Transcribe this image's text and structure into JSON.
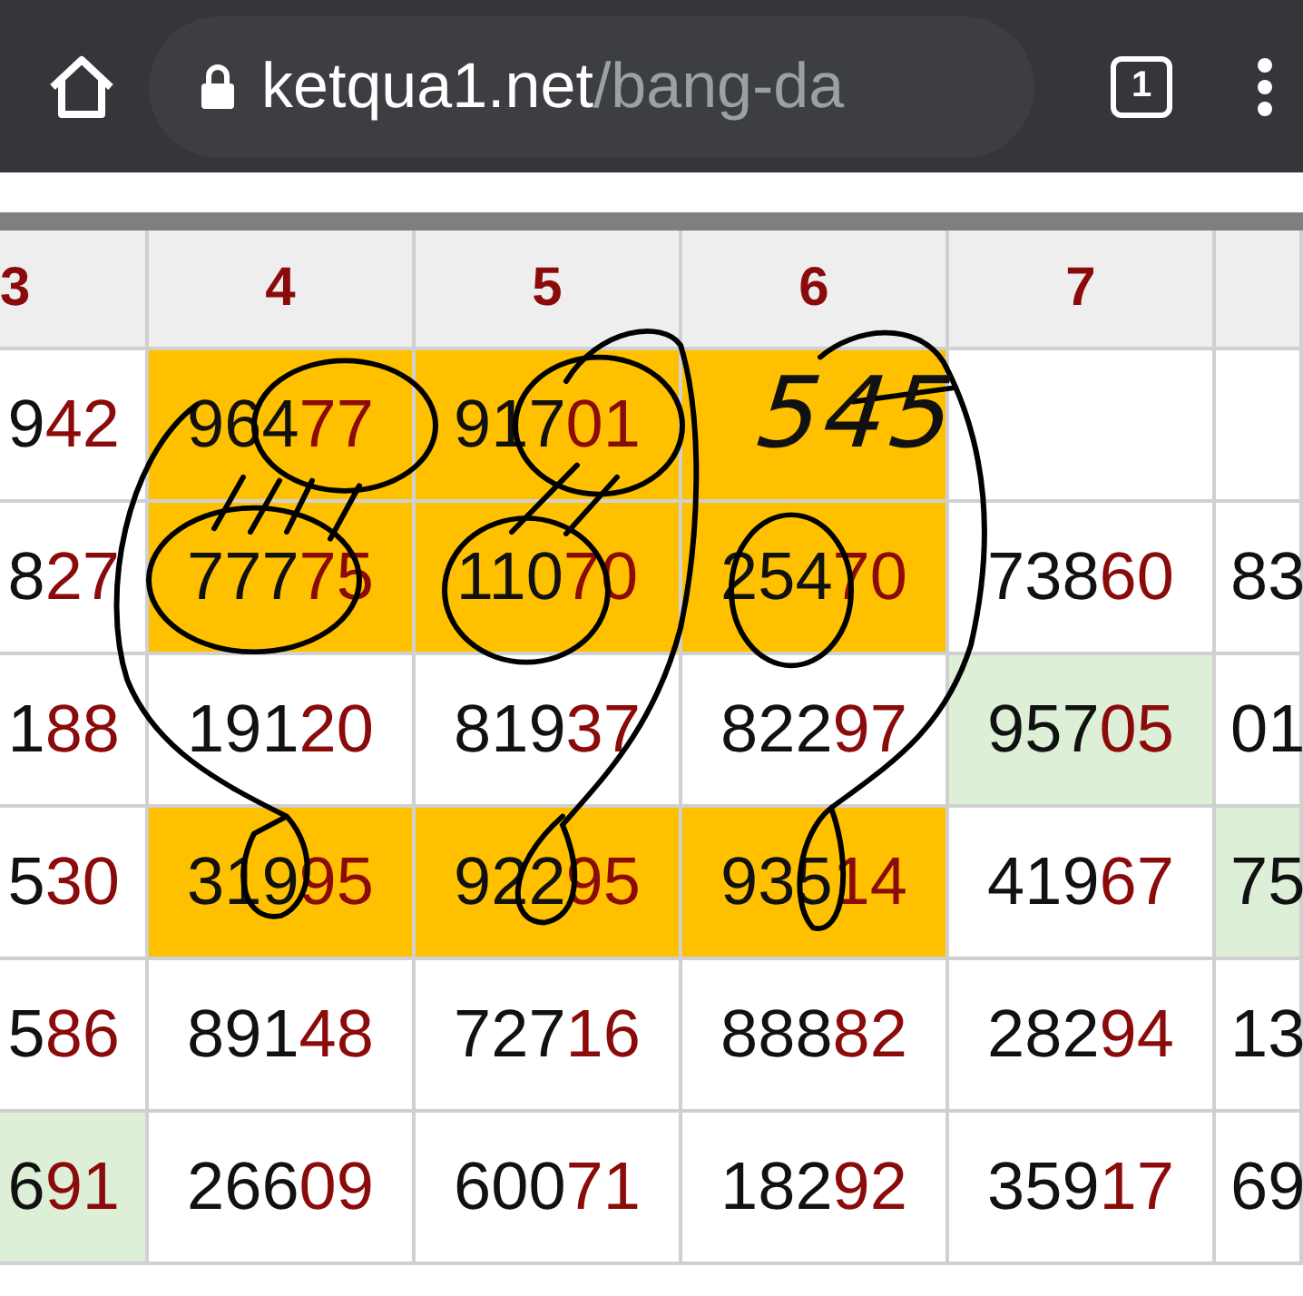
{
  "browser": {
    "url_host": "ketqua1.net",
    "url_path": "/bang-da",
    "tab_count": "1"
  },
  "table": {
    "columns": [
      "3",
      "4",
      "5",
      "6",
      "7"
    ],
    "rows": [
      {
        "cells": [
          {
            "head": "9",
            "tail": "42",
            "color": "#ffffff"
          },
          {
            "head": "964",
            "tail": "77",
            "color": "#ffc000"
          },
          {
            "head": "917",
            "tail": "01",
            "color": "#ffc000"
          },
          {
            "color": "#ffc000"
          },
          {
            "color": "#ffffff"
          },
          {
            "color": "#ffffff"
          }
        ]
      },
      {
        "cells": [
          {
            "head": "8",
            "tail": "27",
            "color": "#ffffff"
          },
          {
            "head": "777",
            "tail": "75",
            "color": "#ffc000"
          },
          {
            "head": "110",
            "tail": "70",
            "color": "#ffc000"
          },
          {
            "head": "254",
            "tail": "70",
            "color": "#ffc000"
          },
          {
            "head": "738",
            "tail": "60",
            "color": "#ffffff"
          },
          {
            "head": "83",
            "color": "#ffffff"
          }
        ]
      },
      {
        "cells": [
          {
            "head": "1",
            "tail": "88",
            "color": "#ffffff"
          },
          {
            "head": "191",
            "tail": "20",
            "color": "#ffffff"
          },
          {
            "head": "819",
            "tail": "37",
            "color": "#ffffff"
          },
          {
            "head": "822",
            "tail": "97",
            "color": "#ffffff"
          },
          {
            "head": "957",
            "tail": "05",
            "color": "#ddefd7"
          },
          {
            "head": "01",
            "color": "#ffffff"
          }
        ]
      },
      {
        "cells": [
          {
            "head": "5",
            "tail": "30",
            "color": "#ffffff"
          },
          {
            "head": "319",
            "tail": "95",
            "color": "#ffc000"
          },
          {
            "head": "922",
            "tail": "95",
            "color": "#ffc000"
          },
          {
            "head": "935",
            "tail": "14",
            "color": "#ffc000"
          },
          {
            "head": "419",
            "tail": "67",
            "color": "#ffffff"
          },
          {
            "head": "75",
            "color": "#ddefd7"
          }
        ]
      },
      {
        "cells": [
          {
            "head": "5",
            "tail": "86",
            "color": "#ffffff"
          },
          {
            "head": "891",
            "tail": "48",
            "color": "#ffffff"
          },
          {
            "head": "727",
            "tail": "16",
            "color": "#ffffff"
          },
          {
            "head": "888",
            "tail": "82",
            "color": "#ffffff"
          },
          {
            "head": "282",
            "tail": "94",
            "color": "#ffffff"
          },
          {
            "head": "13",
            "color": "#ffffff"
          }
        ]
      },
      {
        "cells": [
          {
            "head": "6",
            "tail": "91",
            "color": "#ddefd7"
          },
          {
            "head": "266",
            "tail": "09",
            "color": "#ffffff"
          },
          {
            "head": "600",
            "tail": "71",
            "color": "#ffffff"
          },
          {
            "head": "182",
            "tail": "92",
            "color": "#ffffff"
          },
          {
            "head": "359",
            "tail": "17",
            "color": "#ffffff"
          },
          {
            "head": "69",
            "color": "#ffffff"
          }
        ]
      }
    ]
  },
  "annotation": {
    "text": "545"
  }
}
